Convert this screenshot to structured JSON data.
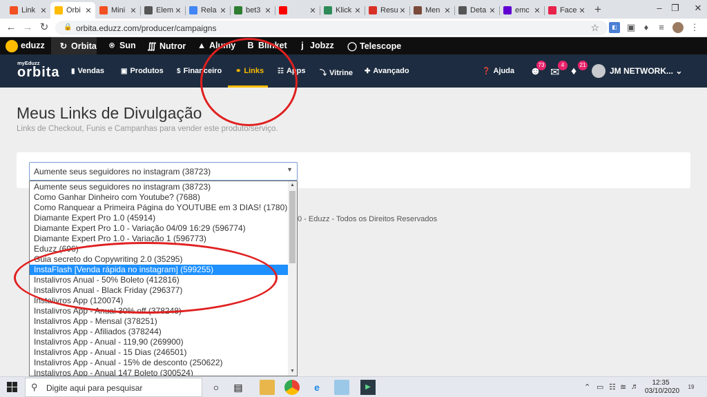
{
  "browser": {
    "tabs": [
      {
        "label": "Link",
        "color": "#f25022",
        "active": false
      },
      {
        "label": "Órbi",
        "color": "#ffbc00",
        "active": true
      },
      {
        "label": "Mini",
        "color": "#f25022",
        "active": false
      },
      {
        "label": "Elem",
        "color": "#555555",
        "active": false
      },
      {
        "label": "Rela",
        "color": "#4285f4",
        "active": false
      },
      {
        "label": "bet3",
        "color": "#2e7d32",
        "active": false
      },
      {
        "label": "",
        "color": "#ff0000",
        "active": false
      },
      {
        "label": "Klick",
        "color": "#2e8b57",
        "active": false
      },
      {
        "label": "Resu",
        "color": "#d93025",
        "active": false
      },
      {
        "label": "Men",
        "color": "#7a4a3a",
        "active": false
      },
      {
        "label": "Deta",
        "color": "#555555",
        "active": false
      },
      {
        "label": "emc",
        "color": "#6001d2",
        "active": false
      },
      {
        "label": "Face",
        "color": "#e8234a",
        "active": false
      }
    ],
    "new_tab": "+",
    "url": "orbita.eduzz.com/producer/campaigns"
  },
  "eduzz_bar": {
    "logo": "eduzz",
    "items": [
      "Orbita",
      "Sun",
      "Nutror",
      "Alumy",
      "Blinket",
      "Jobzz",
      "Telescope"
    ]
  },
  "app_header": {
    "brand_small": "myEduzz",
    "brand_big": "orbita",
    "nav": [
      "Vendas",
      "Produtos",
      "Financeiro",
      "Links",
      "Apps",
      "Vitrine",
      "Avançado"
    ],
    "active_nav": "Links",
    "help": "Ajuda",
    "badges": {
      "users": "73",
      "messages": "4",
      "notifications": "21"
    },
    "user_name": "JM NETWORK..."
  },
  "page": {
    "title": "Meus Links de Divulgação",
    "subtitle": "Links de Checkout, Funis e Campanhas para vender este produto/serviço.",
    "select_value": "Aumente seus seguidores no instagram (38723)",
    "footer": "0 - Eduzz - Todos os Direitos Reservados"
  },
  "dropdown": {
    "selected_index": 8,
    "options": [
      "Aumente seus seguidores no instagram (38723)",
      "Como Ganhar Dinheiro com Youtube? (7688)",
      "Como Ranquear a Primeira Página do YOUTUBE em 3 DIAS! (1780)",
      "Diamante Expert Pro 1.0 (45914)",
      "Diamante Expert Pro 1.0 - Variação 04/09 16:29 (596774)",
      "Diamante Expert Pro 1.0 - Variação 1 (596773)",
      "Eduzz (696)",
      "Guia secreto do Copywriting 2.0 (35295)",
      "InstaFlash [Venda rápida no instagram] (599255)",
      "Instalivros Anual - 50% Boleto (412816)",
      "Instalivros Anual - Black Friday (296377)",
      "Instalivros App (120074)",
      "Instalivros App - Anual 30% off (378248)",
      "Instalivros App - Mensal (378251)",
      "Instalivros App - Afiliados (378244)",
      "Instalivros App - Anual - 119,90 (269900)",
      "Instalivros App - Anual - 15 Dias (246501)",
      "Instalivros App - Anual - 15% de desconto (250622)",
      "Instalivros App - Anual 147 Boleto (300524)"
    ]
  },
  "taskbar": {
    "search_placeholder": "Digite aqui para pesquisar",
    "time": "12:35",
    "date": "03/10/2020",
    "notifications": "19"
  },
  "colors": {
    "accent": "#ffbc00",
    "header": "#1d2c40",
    "annotation": "#e02020",
    "selection": "#1e90ff"
  }
}
